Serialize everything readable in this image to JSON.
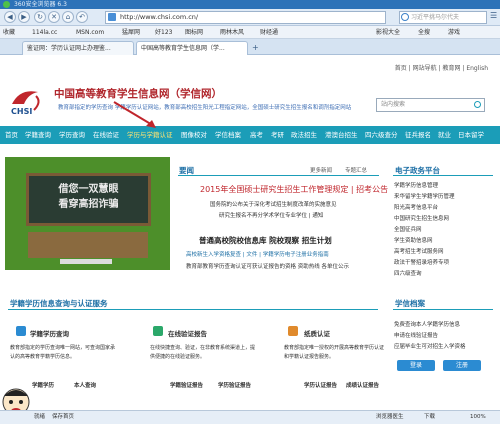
{
  "browser": {
    "title": "360安全浏览器 6.3",
    "address": "http://www.chsi.com.cn/",
    "search_placeholder": "习近平挑马尔代夫",
    "favorites": [
      "收藏",
      "114la.cc",
      "MSN.com",
      "猛犀网",
      "好123",
      "图标网",
      "雨林木风",
      "财经通"
    ],
    "right_tools": [
      "影视大全",
      "全搜",
      "游戏"
    ],
    "tabs": [
      "鉴证网：学历认证网上办理鉴...",
      "中国高等教育学生信息网（学..."
    ]
  },
  "site": {
    "top_links": [
      "首页",
      "网站导航",
      "教育网",
      "English"
    ],
    "title": "中国高等教育学生信息网（学信网）",
    "subtitle": "教育部指定的学历查询  学籍学历认证网站，教育部高校招生阳光工程指定网站，全国硕士研究生招生报名和调剂指定网站",
    "logo_text": "CHSI",
    "search_placeholder": "站内搜索",
    "nav": [
      "首页",
      "学籍查询",
      "学历查询",
      "在线验证",
      "学历与学籍认证",
      "图像校对",
      "学信档案",
      "高考",
      "考研",
      "政法招生",
      "港澳台招生",
      "四六级查分",
      "征兵报名",
      "就业",
      "日本留学"
    ],
    "active_nav_index": 4
  },
  "banner": {
    "line1": "借您一双慧眼",
    "line2": "看穿高招诈骗"
  },
  "news": {
    "title": "要闻",
    "more": "更多新闻",
    "special": "专题汇总",
    "headline": "2015年全国硕士研究生招生工作管理规定 | 招考公告",
    "items": [
      "国务院的公布关于深化考试招生制度改革的实施意见",
      "研究生报名不再分学术学位专业学位 | 通知"
    ],
    "headline2": "普通高校院校信息库  院校观察  招生计划",
    "items2": [
      "高校新生入学资格复查 | 文件 | 学籍学历电子注册业务指南",
      "教育部教育学历查询认证可获认证报告的资格 资助热线  各单位公示"
    ]
  },
  "right_panel": {
    "title": "电子政务平台",
    "items": [
      "学籍学历信息管理",
      "来华留学生学籍学历管理",
      "阳光高考信息平台",
      "中国研究生招生信息网",
      "全国征兵网",
      "学生资助信息网",
      "高考招生考试服务网",
      "政法干警招录培养专项",
      "四六级查询"
    ]
  },
  "service": {
    "title": "学籍学历信息查询与认证服务",
    "cards": [
      {
        "title": "学籍学历查询",
        "desc": "教育部指定的学历查询唯一网站，可查询国家承认的高等教育学籍学历信息。"
      },
      {
        "title": "在线验证报告",
        "desc": "在线快捷查询、验证，在非教育系统渠道上，提供便捷的在线验证服务。"
      },
      {
        "title": "纸质认证",
        "desc": "教育部指定唯一授权的开展高等教育学历认证和学籍认证报告服务。"
      }
    ],
    "sub_left": [
      "学籍学历",
      "本人查询"
    ],
    "sub_mid": [
      "学籍验证报告",
      "学历验证报告"
    ],
    "sub_right": [
      "学历认证报告",
      "成绩认证报告"
    ]
  },
  "archive": {
    "title": "学信档案",
    "desc": [
      "免费查询本人学籍学历信息",
      "申请在线验证报告",
      "应届毕业生可对招生入学资格"
    ],
    "login": "登录",
    "register": "注册"
  },
  "status": {
    "left": "就绪",
    "middle": "保存首页",
    "items": [
      "浏览器医生",
      "下载",
      "100%"
    ]
  }
}
